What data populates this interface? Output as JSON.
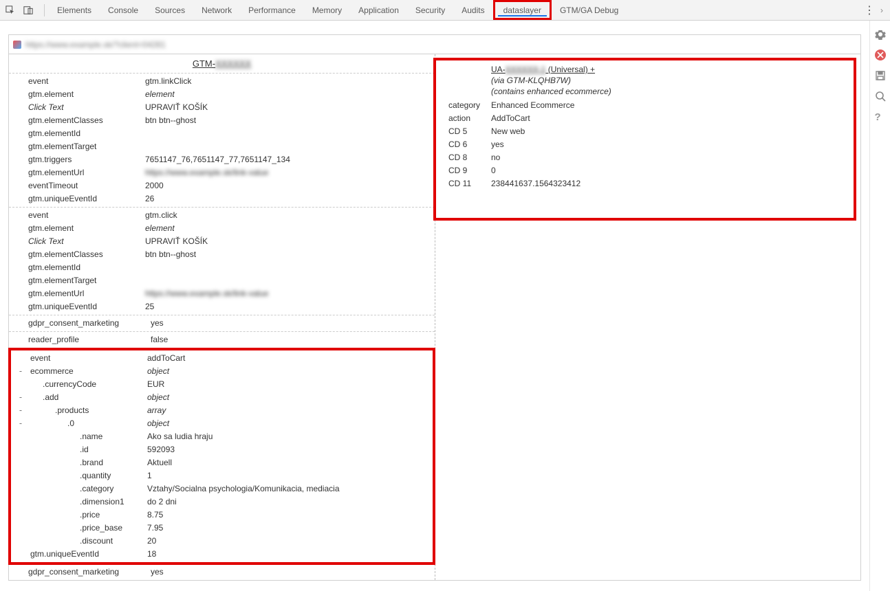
{
  "tabs": [
    "Elements",
    "Console",
    "Sources",
    "Network",
    "Performance",
    "Memory",
    "Application",
    "Security",
    "Audits",
    "dataslayer",
    "GTM/GA Debug"
  ],
  "left_header": "GTM-",
  "events": {
    "e1": [
      {
        "k": "event",
        "v": "gtm.linkClick"
      },
      {
        "k": "gtm.element",
        "v": "element",
        "vi": true
      },
      {
        "k": "Click Text",
        "v": "UPRAVIŤ KOŠÍK",
        "ki": true
      },
      {
        "k": "gtm.elementClasses",
        "v": "btn btn--ghost"
      },
      {
        "k": "gtm.elementId",
        "v": ""
      },
      {
        "k": "gtm.elementTarget",
        "v": ""
      },
      {
        "k": "gtm.triggers",
        "v": "7651147_76,7651147_77,7651147_134"
      },
      {
        "k": "gtm.elementUrl",
        "v": "",
        "blur": true
      },
      {
        "k": "eventTimeout",
        "v": "2000"
      },
      {
        "k": "gtm.uniqueEventId",
        "v": "26"
      }
    ],
    "e2": [
      {
        "k": "event",
        "v": "gtm.click"
      },
      {
        "k": "gtm.element",
        "v": "element",
        "vi": true
      },
      {
        "k": "Click Text",
        "v": "UPRAVIŤ KOŠÍK",
        "ki": true
      },
      {
        "k": "gtm.elementClasses",
        "v": "btn btn--ghost"
      },
      {
        "k": "gtm.elementId",
        "v": ""
      },
      {
        "k": "gtm.elementTarget",
        "v": ""
      },
      {
        "k": "gtm.elementUrl",
        "v": "h",
        "blur": true
      },
      {
        "k": "gtm.uniqueEventId",
        "v": "25"
      }
    ],
    "consent1": {
      "k": "gdpr_consent_marketing",
      "v": "yes"
    },
    "reader": {
      "k": "reader_profile",
      "v": "false"
    },
    "e3": [
      {
        "t": "",
        "k": "event",
        "v": "addToCart",
        "i": 0
      },
      {
        "t": "-",
        "k": "ecommerce",
        "v": "object",
        "vi": true,
        "i": 0
      },
      {
        "t": "",
        "k": ".currencyCode",
        "v": "EUR",
        "i": 1
      },
      {
        "t": "-",
        "k": ".add",
        "v": "object",
        "vi": true,
        "i": 1
      },
      {
        "t": "-",
        "k": ".products",
        "v": "array",
        "vi": true,
        "i": 2
      },
      {
        "t": "-",
        "k": ".0",
        "v": "object",
        "vi": true,
        "i": 3
      },
      {
        "t": "",
        "k": ".name",
        "v": "Ako sa ludia hraju",
        "i": 4
      },
      {
        "t": "",
        "k": ".id",
        "v": "592093",
        "i": 4
      },
      {
        "t": "",
        "k": ".brand",
        "v": "Aktuell",
        "i": 4
      },
      {
        "t": "",
        "k": ".quantity",
        "v": "1",
        "i": 4
      },
      {
        "t": "",
        "k": ".category",
        "v": "Vztahy/Socialna psychologia/Komunikacia, mediacia",
        "i": 4
      },
      {
        "t": "",
        "k": ".dimension1",
        "v": "do 2 dni",
        "i": 4
      },
      {
        "t": "",
        "k": ".price",
        "v": "8.75",
        "i": 4
      },
      {
        "t": "",
        "k": ".price_base",
        "v": "7.95",
        "i": 4
      },
      {
        "t": "",
        "k": ".discount",
        "v": "20",
        "i": 4
      },
      {
        "t": "",
        "k": "gtm.uniqueEventId",
        "v": "18",
        "i": 0
      }
    ],
    "consent2": {
      "k": "gdpr_consent_marketing",
      "v": "yes"
    }
  },
  "right": {
    "ua_prefix": "UA-",
    "ua_suffix": " (Universal) +",
    "via": "(via GTM-KLQHB7W)",
    "contains": "(contains enhanced ecommerce)",
    "rows": [
      {
        "k": "category",
        "v": "Enhanced Ecommerce"
      },
      {
        "k": "action",
        "v": "AddToCart"
      },
      {
        "k": "CD 5",
        "v": "New web"
      },
      {
        "k": "CD 6",
        "v": "yes"
      },
      {
        "k": "CD 8",
        "v": "no"
      },
      {
        "k": "CD 9",
        "v": "0"
      },
      {
        "k": "CD 11",
        "v": "238441637.1564323412"
      }
    ]
  }
}
